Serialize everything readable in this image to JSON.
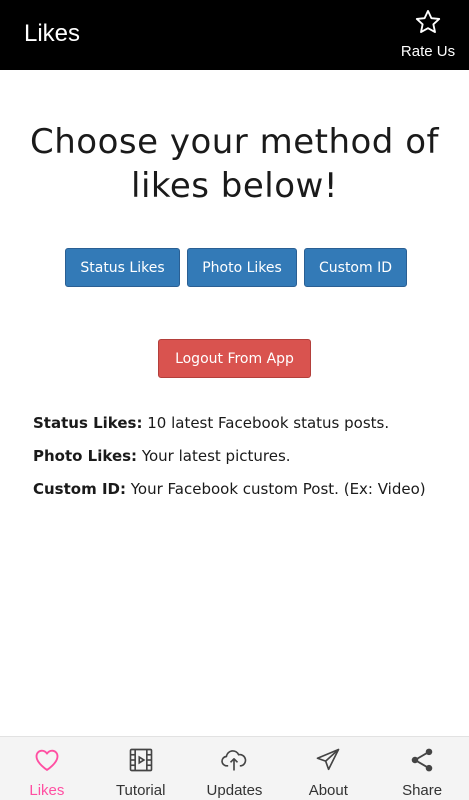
{
  "topbar": {
    "title": "Likes",
    "rate": {
      "label": "Rate Us",
      "icon": "star-outline-icon"
    }
  },
  "main": {
    "headline": "Choose your method of likes below!",
    "methods": [
      {
        "label": "Status Likes"
      },
      {
        "label": "Photo Likes"
      },
      {
        "label": "Custom ID"
      }
    ],
    "logout_label": "Logout From App",
    "info": [
      {
        "term": "Status Likes:",
        "desc": " 10 latest Facebook status posts."
      },
      {
        "term": "Photo Likes:",
        "desc": " Your latest pictures."
      },
      {
        "term": "Custom ID:",
        "desc": " Your Facebook custom Post. (Ex: Video)"
      }
    ]
  },
  "bottom_nav": {
    "tabs": [
      {
        "label": "Likes",
        "icon": "heart-icon",
        "active": true
      },
      {
        "label": "Tutorial",
        "icon": "film-icon",
        "active": false
      },
      {
        "label": "Updates",
        "icon": "cloud-upload-icon",
        "active": false
      },
      {
        "label": "About",
        "icon": "send-icon",
        "active": false
      },
      {
        "label": "Share",
        "icon": "share-icon",
        "active": false
      }
    ]
  },
  "colors": {
    "topbar_bg": "#000000",
    "primary_button": "#337ab7",
    "danger_button": "#d9534f",
    "active_tab": "#ff4fa2"
  }
}
